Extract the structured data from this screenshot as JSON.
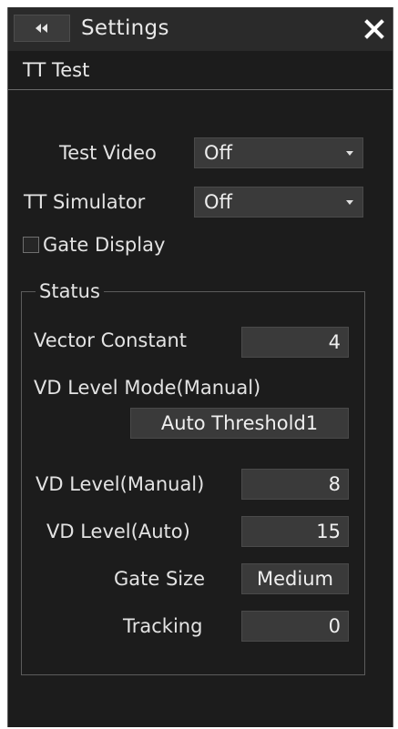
{
  "window": {
    "title": "Settings",
    "back_icon": "double-chevron-left-icon",
    "close_icon": "close-icon"
  },
  "page": {
    "subtitle": "TT Test"
  },
  "settings": {
    "test_video": {
      "label": "Test Video",
      "value": "Off"
    },
    "tt_simulator": {
      "label": "TT Simulator",
      "value": "Off"
    },
    "gate_display": {
      "label": "Gate Display",
      "checked": false
    }
  },
  "status": {
    "title": "Status",
    "vector_constant": {
      "label": "Vector Constant",
      "value": "4"
    },
    "vd_level_mode": {
      "label": "VD Level Mode(Manual)",
      "value": "Auto Threshold1"
    },
    "vd_level_manual": {
      "label": "VD Level(Manual)",
      "value": "8"
    },
    "vd_level_auto": {
      "label": "VD Level(Auto)",
      "value": "15"
    },
    "gate_size": {
      "label": "Gate Size",
      "value": "Medium"
    },
    "tracking": {
      "label": "Tracking",
      "value": "0"
    }
  },
  "colors": {
    "panel_bg": "#1c1c1c",
    "field_bg": "#3a3a3a",
    "text": "#e3e3e3"
  }
}
